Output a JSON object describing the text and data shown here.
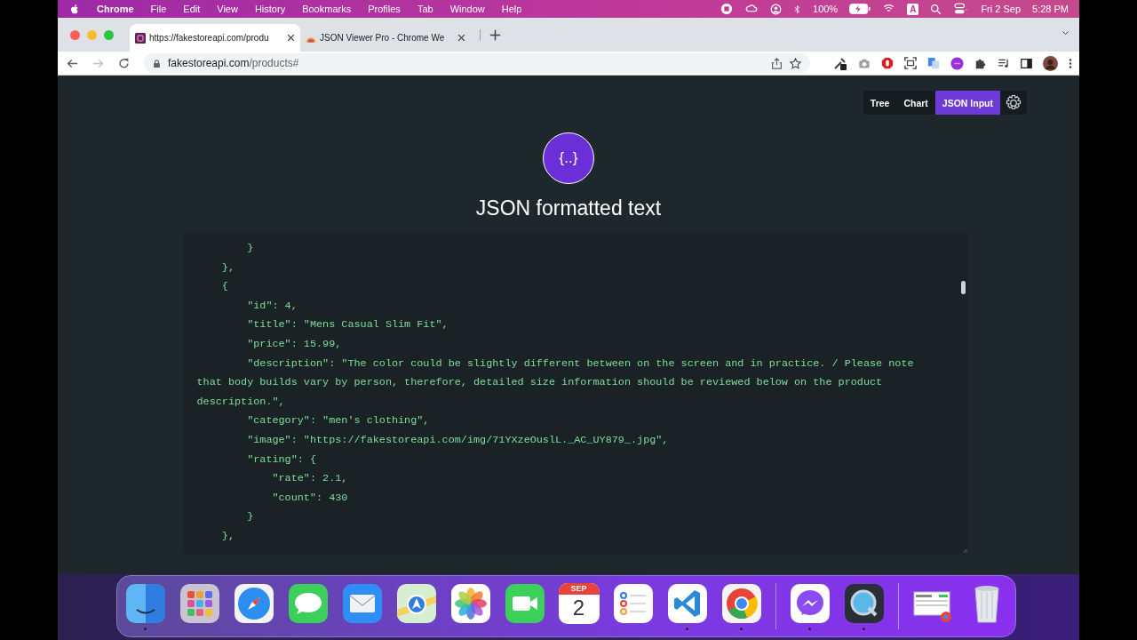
{
  "menu_bar": {
    "app": "Chrome",
    "menus": [
      "File",
      "Edit",
      "View",
      "History",
      "Bookmarks",
      "Profiles",
      "Tab",
      "Window",
      "Help"
    ],
    "battery": "100%",
    "input_source": "A",
    "date": "Fri 2 Sep",
    "time": "5:28 PM"
  },
  "tabs": [
    {
      "title": "https://fakestoreapi.com/produ",
      "selected": true
    },
    {
      "title": "JSON Viewer Pro - Chrome We",
      "selected": false
    }
  ],
  "address": {
    "host": "fakestoreapi.com",
    "path": "/products#"
  },
  "view_tabs": [
    {
      "label": "Tree",
      "selected": false
    },
    {
      "label": "Chart",
      "selected": false
    },
    {
      "label": "JSON Input",
      "selected": true
    }
  ],
  "logo_text": "{..}",
  "heading": "JSON formatted text",
  "code_lines": [
    "        }",
    "    },",
    "    {",
    "        \"id\": 4,",
    "        \"title\": \"Mens Casual Slim Fit\",",
    "        \"price\": 15.99,",
    "        \"description\": \"The color could be slightly different between on the screen and in practice. / Please note that body builds vary by person, therefore, detailed size information should be reviewed below on the product description.\",",
    "        \"category\": \"men's clothing\",",
    "        \"image\": \"https://fakestoreapi.com/img/71YXzeOuslL._AC_UY879_.jpg\",",
    "        \"rating\": {",
    "            \"rate\": 2.1,",
    "            \"count\": 430",
    "        }",
    "    },"
  ],
  "dock": [
    {
      "kind": "finder",
      "running": true
    },
    {
      "kind": "launchpad",
      "running": false
    },
    {
      "kind": "safari",
      "running": false
    },
    {
      "kind": "messages",
      "running": false
    },
    {
      "kind": "mail",
      "running": false
    },
    {
      "kind": "maps",
      "running": false
    },
    {
      "kind": "photos",
      "running": false
    },
    {
      "kind": "facetime",
      "running": false
    },
    {
      "kind": "calendar",
      "running": false,
      "month": "SEP",
      "day": "2"
    },
    {
      "kind": "reminders",
      "running": false
    },
    {
      "kind": "vscode",
      "running": true
    },
    {
      "kind": "chrome",
      "running": true
    },
    {
      "kind": "divider"
    },
    {
      "kind": "messenger",
      "running": true
    },
    {
      "kind": "quicktime",
      "running": true
    },
    {
      "kind": "divider"
    },
    {
      "kind": "preview",
      "running": false
    },
    {
      "kind": "trash",
      "running": false
    }
  ]
}
